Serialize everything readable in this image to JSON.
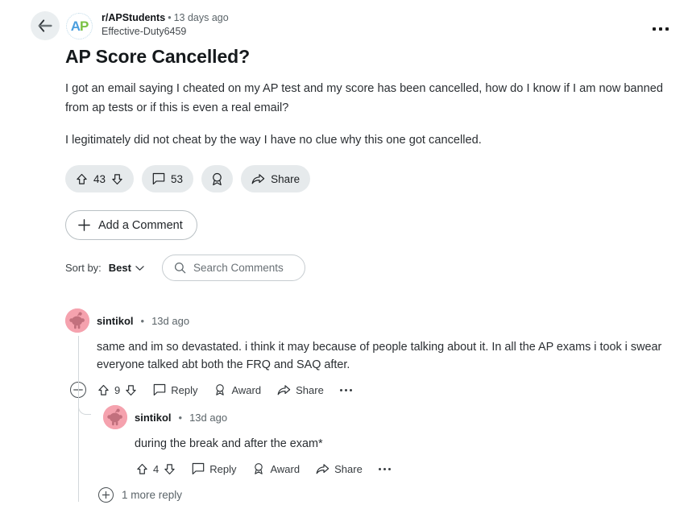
{
  "post": {
    "subreddit": "r/APStudents",
    "separator": "•",
    "age": "13 days ago",
    "author": "Effective-Duty6459",
    "title": "AP Score Cancelled?",
    "paragraphs": [
      "I got an email saying I cheated on my AP test and my score has been cancelled, how do I know if I am now banned from ap tests or if this is even a real email?",
      "I legitimately did not cheat by the way I have no clue why this one got cancelled."
    ],
    "avatar_letters": {
      "a": "A",
      "p": "P"
    },
    "actions": {
      "upvote_count": "43",
      "comment_count": "53",
      "share_label": "Share"
    },
    "add_comment_label": "Add a Comment"
  },
  "sort": {
    "label": "Sort by:",
    "value": "Best"
  },
  "search": {
    "placeholder": "Search Comments"
  },
  "comments": [
    {
      "author": "sintikol",
      "separator": "•",
      "age": "13d ago",
      "text": "same and im so devastated. i think it may because of people talking about it. In all the AP exams i took i swear everyone talked abt both the FRQ and SAQ after.",
      "score": "9",
      "reply_label": "Reply",
      "award_label": "Award",
      "share_label": "Share"
    },
    {
      "author": "sintikol",
      "separator": "•",
      "age": "13d ago",
      "text": "during the break and after the exam*",
      "score": "4",
      "reply_label": "Reply",
      "award_label": "Award",
      "share_label": "Share"
    }
  ],
  "more_replies_label": "1 more reply",
  "colors": {
    "pill_bg": "#e6eaec",
    "avatar_pink": "#f5a2ae",
    "snoo_pink": "#c2707d",
    "logo_blue": "#4a9ede",
    "logo_green": "#7ac143",
    "thread_line": "#d3d8db"
  }
}
